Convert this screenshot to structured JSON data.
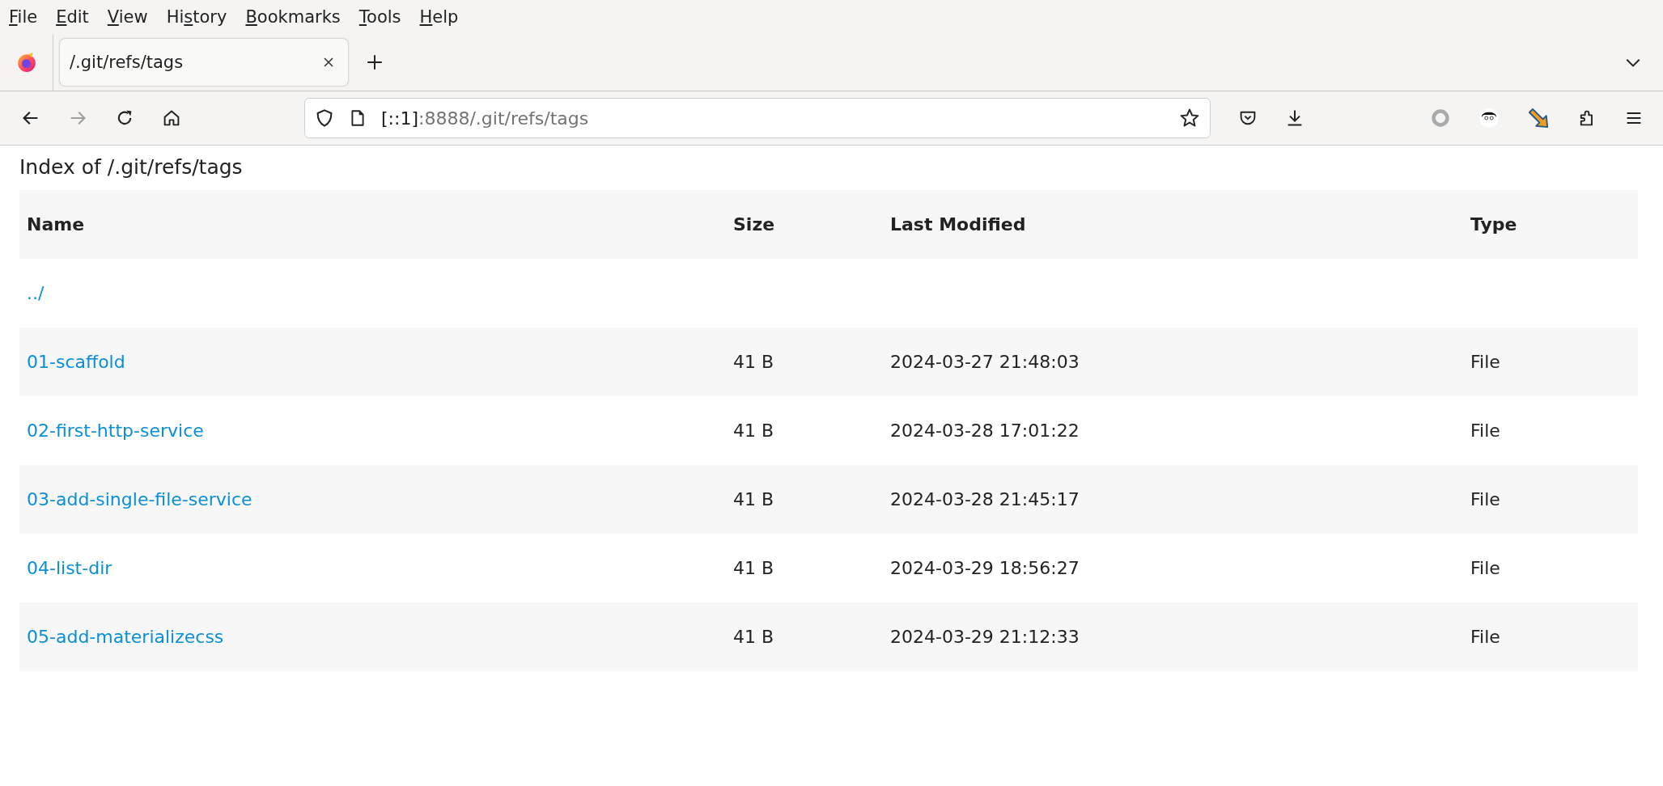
{
  "menu_bar": [
    {
      "access_key": "F",
      "after": "ile"
    },
    {
      "access_key": "E",
      "after": "dit"
    },
    {
      "access_key": "V",
      "after": "iew"
    },
    {
      "before": "Hi",
      "access_key": "s",
      "after": "tory"
    },
    {
      "access_key": "B",
      "after": "ookmarks"
    },
    {
      "access_key": "T",
      "after": "ools"
    },
    {
      "access_key": "H",
      "after": "elp"
    }
  ],
  "tabs": [
    {
      "title": "/.git/refs/tags",
      "selected": true
    }
  ],
  "toolbar": {
    "forward_disabled": true,
    "address": {
      "host": "[::1]",
      "path": ":8888/.git/refs/tags"
    }
  },
  "page": {
    "heading": "Index of /.git/refs/tags",
    "table": {
      "columns": [
        "Name",
        "Size",
        "Last Modified",
        "Type"
      ],
      "rows": [
        {
          "name": "../"
        },
        {
          "name": "01-scaffold",
          "size": "41 B",
          "modified": "2024-03-27 21:48:03",
          "type": "File"
        },
        {
          "name": "02-first-http-service",
          "size": "41 B",
          "modified": "2024-03-28 17:01:22",
          "type": "File"
        },
        {
          "name": "03-add-single-file-service",
          "size": "41 B",
          "modified": "2024-03-28 21:45:17",
          "type": "File"
        },
        {
          "name": "04-list-dir",
          "size": "41 B",
          "modified": "2024-03-29 18:56:27",
          "type": "File"
        },
        {
          "name": "05-add-materializecss",
          "size": "41 B",
          "modified": "2024-03-29 21:12:33",
          "type": "File"
        }
      ]
    }
  }
}
